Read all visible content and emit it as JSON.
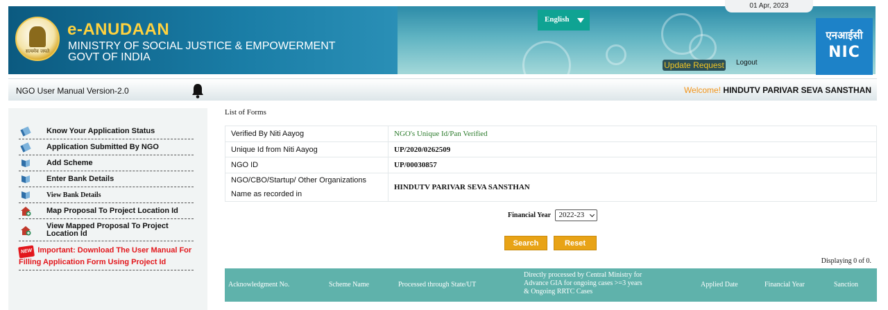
{
  "header": {
    "brand": "e-ANUDAAN",
    "ministry": "MINISTRY OF SOCIAL JUSTICE & EMPOWERMENT",
    "govt": "GOVT OF INDIA",
    "emblem_caption": "सत्यमेव जयते",
    "language": "English",
    "date": "01 Apr, 2023",
    "update_request": "Update Request",
    "logout": "Logout",
    "nic_hindi": "एनआईसी",
    "nic_en": "NIC"
  },
  "subbar": {
    "manual": "NGO User Manual Version-2.0",
    "welcome_label": "Welcome!",
    "user_name": "HINDUTV PARIVAR SEVA SANSTHAN"
  },
  "sidebar": {
    "items": [
      {
        "label": "Know Your Application Status",
        "icon": "books-icon"
      },
      {
        "label": "Application Submitted By NGO",
        "icon": "books-icon"
      },
      {
        "label": "Add Scheme",
        "icon": "book-open-icon"
      },
      {
        "label": "Enter Bank Details",
        "icon": "book-open-icon"
      },
      {
        "label": "View Bank Details",
        "icon": "book-open-icon"
      },
      {
        "label": "Map Proposal To Project Location Id",
        "icon": "house-add-icon"
      },
      {
        "label": "View Mapped Proposal To Project Location Id",
        "icon": "house-add-icon"
      }
    ],
    "important_badge": "NEW",
    "important": "Important: Download The User Manual For Filling Application Form Using Project Id"
  },
  "main": {
    "list_title": "List of Forms",
    "rows": [
      {
        "key": "Verified By Niti Aayog",
        "value": "NGO's Unique Id/Pan Verified"
      },
      {
        "key": "Unique Id from Niti Aayog",
        "value": "UP/2020/0262509"
      },
      {
        "key": "NGO ID",
        "value": "UP/00030857"
      },
      {
        "key": "NGO/CBO/Startup/ Other Organizations Name as recorded in",
        "value": "HINDUTV PARIVAR SEVA SANSTHAN"
      }
    ],
    "fy_label": "Financial Year",
    "fy_value": "2022-23",
    "search": "Search",
    "reset": "Reset",
    "displaying": "Displaying 0 of 0.",
    "columns": [
      "Acknowledgment No.",
      "Scheme Name",
      "Processed through State/UT",
      "Directly processed by Central Ministry for Advance GIA for ongoing cases >=3 years & Ongoing RRTC Cases",
      "Applied Date",
      "Financial Year",
      "Sanction"
    ]
  },
  "colors": {
    "header_blue": "#1a7da6",
    "brand_yellow": "#ffd23f",
    "lang_teal": "#0fa393",
    "button_orange": "#e8a316",
    "grid_teal": "#5fb2ab",
    "nic_blue": "#1d82c8",
    "important_red": "#e2171c"
  }
}
